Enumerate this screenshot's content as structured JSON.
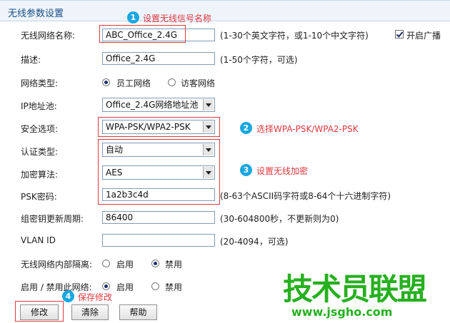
{
  "header": {
    "title": "无线参数设置"
  },
  "fields": {
    "ssid": {
      "label": "无线网络名称:",
      "value": "ABC_Office_2.4G",
      "hint": "(1-30个英文字符，或1-10个中文字符)",
      "broadcast_label": "开启广播",
      "broadcast_checked": true
    },
    "desc": {
      "label": "描述:",
      "value": "Office_2.4G",
      "hint": "(1-50个字符，可选)"
    },
    "net_type": {
      "label": "网络类型:",
      "options": [
        "员工网络",
        "访客网络"
      ],
      "selected": "员工网络"
    },
    "ip_pool": {
      "label": "IP地址池:",
      "value": "Office_2.4G网络地址池"
    },
    "security": {
      "label": "安全选项:",
      "value": "WPA-PSK/WPA2-PSK"
    },
    "auth": {
      "label": "认证类型:",
      "value": "自动"
    },
    "encrypt": {
      "label": "加密算法:",
      "value": "AES"
    },
    "psk": {
      "label": "PSK密码:",
      "value": "1a2b3c4d",
      "hint": "(8-63个ASCII码字符或8-64个十六进制字符)"
    },
    "rekey": {
      "label": "组密钥更新周期:",
      "value": "86400",
      "hint": "(30-604800秒，不更新则为0)"
    },
    "vlan": {
      "label": "VLAN ID",
      "value": "",
      "hint": "(20-4094，可选)"
    },
    "isolation": {
      "label": "无线网络内部隔离:",
      "options": [
        "启用",
        "禁用"
      ],
      "selected": "禁用"
    },
    "enable": {
      "label": "启用 / 禁用此网络:",
      "options": [
        "启用",
        "禁用"
      ],
      "selected": "启用"
    }
  },
  "buttons": {
    "modify": "修改",
    "clear": "清除",
    "help": "帮助"
  },
  "annotations": {
    "n1": {
      "num": "1",
      "text": "设置无线信号名称"
    },
    "n2": {
      "num": "2",
      "text": "选择WPA-PSK/WPA2-PSK"
    },
    "n3": {
      "num": "3",
      "text": "设置无线加密"
    },
    "n4": {
      "num": "4",
      "text": "保存修改"
    }
  },
  "watermark": {
    "text": "技术员联盟",
    "url": "www.jsgho.com"
  },
  "colors": {
    "annotation_red": "#e0393e",
    "badge_blue": "#19a7e2",
    "header_bg": "#eef4fa",
    "watermark_green": "#26b01f"
  }
}
